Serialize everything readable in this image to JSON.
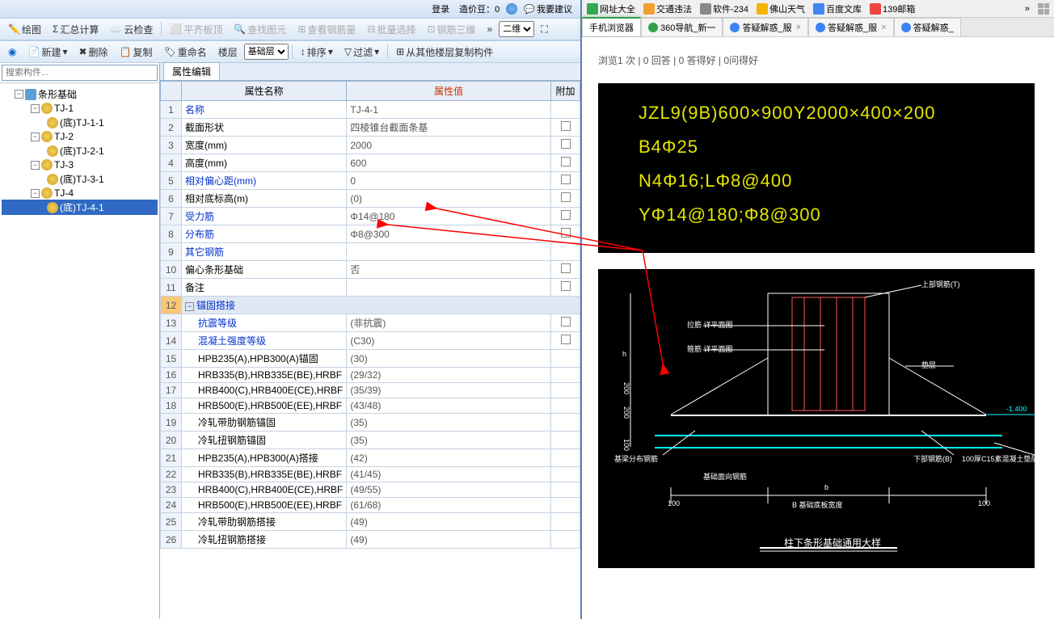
{
  "titlebar": {
    "login": "登录",
    "price": "造价豆：0",
    "feedback": "我要建议"
  },
  "toolbar1": {
    "draw": "绘图",
    "sum": "汇总计算",
    "cloud": "云检查",
    "flat": "平齐板顶",
    "find": "查找图元",
    "rebar": "查看钢筋量",
    "batch": "批量选择",
    "rebar3d": "钢筋三维",
    "view_select": "二维"
  },
  "toolbar2": {
    "new": "新建",
    "delete": "删除",
    "copy": "复制",
    "rename": "重命名",
    "floor": "楼层",
    "layer_select": "基础层",
    "sort": "排序",
    "filter": "过滤",
    "copy_from": "从其他楼层复制构件"
  },
  "search_placeholder": "搜索构件...",
  "tree": {
    "root": "条形基础",
    "items": [
      {
        "label": "TJ-1",
        "children": [
          "(底)TJ-1-1"
        ]
      },
      {
        "label": "TJ-2",
        "children": [
          "(底)TJ-2-1"
        ]
      },
      {
        "label": "TJ-3",
        "children": [
          "(底)TJ-3-1"
        ]
      },
      {
        "label": "TJ-4",
        "children": [
          "(底)TJ-4-1"
        ]
      }
    ],
    "selected": "(底)TJ-4-1"
  },
  "prop_tab": "属性编辑",
  "prop_headers": {
    "name": "属性名称",
    "value": "属性值",
    "extra": "附加"
  },
  "props": [
    {
      "n": 1,
      "name": "名称",
      "val": "TJ-4-1",
      "blue": true,
      "check": false
    },
    {
      "n": 2,
      "name": "截面形状",
      "val": "四棱锥台截面条基",
      "check": true
    },
    {
      "n": 3,
      "name": "宽度(mm)",
      "val": "2000",
      "check": true
    },
    {
      "n": 4,
      "name": "高度(mm)",
      "val": "600",
      "check": true
    },
    {
      "n": 5,
      "name": "相对偏心距(mm)",
      "val": "0",
      "blue": true,
      "check": true
    },
    {
      "n": 6,
      "name": "相对底标高(m)",
      "val": "(0)",
      "check": true
    },
    {
      "n": 7,
      "name": "受力筋",
      "val": "Φ14@180",
      "blue": true,
      "check": true
    },
    {
      "n": 8,
      "name": "分布筋",
      "val": "Φ8@300",
      "blue": true,
      "check": true
    },
    {
      "n": 9,
      "name": "其它钢筋",
      "val": "",
      "blue": true,
      "check": false
    },
    {
      "n": 10,
      "name": "偏心条形基础",
      "val": "否",
      "check": true
    },
    {
      "n": 11,
      "name": "备注",
      "val": "",
      "check": true
    },
    {
      "n": 12,
      "name": "锚固搭接",
      "group": true,
      "sel": true
    },
    {
      "n": 13,
      "name": "抗震等级",
      "val": "(非抗震)",
      "indent": true,
      "blue": true,
      "check": true
    },
    {
      "n": 14,
      "name": "混凝土强度等级",
      "val": "(C30)",
      "indent": true,
      "blue": true,
      "check": true
    },
    {
      "n": 15,
      "name": "HPB235(A),HPB300(A)锚固",
      "val": "(30)",
      "indent": true,
      "check": false
    },
    {
      "n": 16,
      "name": "HRB335(B),HRB335E(BE),HRBF",
      "val": "(29/32)",
      "indent": true,
      "check": false
    },
    {
      "n": 17,
      "name": "HRB400(C),HRB400E(CE),HRBF",
      "val": "(35/39)",
      "indent": true,
      "check": false
    },
    {
      "n": 18,
      "name": "HRB500(E),HRB500E(EE),HRBF",
      "val": "(43/48)",
      "indent": true,
      "check": false
    },
    {
      "n": 19,
      "name": "冷轧带肋钢筋锚固",
      "val": "(35)",
      "indent": true,
      "check": false
    },
    {
      "n": 20,
      "name": "冷轧扭钢筋锚固",
      "val": "(35)",
      "indent": true,
      "check": false
    },
    {
      "n": 21,
      "name": "HPB235(A),HPB300(A)搭接",
      "val": "(42)",
      "indent": true,
      "check": false
    },
    {
      "n": 22,
      "name": "HRB335(B),HRB335E(BE),HRBF",
      "val": "(41/45)",
      "indent": true,
      "check": false
    },
    {
      "n": 23,
      "name": "HRB400(C),HRB400E(CE),HRBF",
      "val": "(49/55)",
      "indent": true,
      "check": false
    },
    {
      "n": 24,
      "name": "HRB500(E),HRB500E(EE),HRBF",
      "val": "(61/68)",
      "indent": true,
      "check": false
    },
    {
      "n": 25,
      "name": "冷轧带肋钢筋搭接",
      "val": "(49)",
      "indent": true,
      "check": false
    },
    {
      "n": 26,
      "name": "冷轧扭钢筋搭接",
      "val": "(49)",
      "indent": true,
      "check": false
    }
  ],
  "bookmarks": [
    {
      "label": "网址大全",
      "color": "#34a853"
    },
    {
      "label": "交通违法",
      "color": "#f0a030"
    },
    {
      "label": "软件-234",
      "color": "#888"
    },
    {
      "label": "佛山天气",
      "color": "#f4b400"
    },
    {
      "label": "百度文库",
      "color": "#4285f4"
    },
    {
      "label": "139邮箱",
      "color": "#e44"
    }
  ],
  "btabs": [
    {
      "label": "手机浏览器",
      "active": true
    },
    {
      "label": "360导航_新一",
      "icon": "green"
    },
    {
      "label": "答疑解惑_服",
      "icon": "blue",
      "close": true
    },
    {
      "label": "答疑解惑_服",
      "icon": "blue",
      "close": true
    },
    {
      "label": "答疑解惑_",
      "icon": "blue"
    }
  ],
  "stats_text": "浏览1 次 | 0 回答 | 0 答得好 | 0问得好",
  "cad_lines": [
    "JZL9(9B)600×900Y2000×400×200",
    "B4Φ25",
    "N4Φ16;LΦ8@400",
    "YΦ14@180;Φ8@300"
  ],
  "cad2_title": "柱下条形基础通用大样",
  "cad2_labels": {
    "top_rebar": "上部钢筋(T)",
    "strap": "拉筋 详平面图",
    "stirrup": "箍筋 详平面图",
    "pad": "垫层",
    "elev": "-1.400",
    "dist_rebar": "基梁分布钢筋",
    "bot_rebar": "下部钢筋(B)",
    "note": "100厚C15素混凝土垫层",
    "tie": "基础面向钢筋",
    "width_label": "B 基础底板宽度",
    "dim100a": "100",
    "dim100b": "100",
    "dim100c": "100",
    "dim200a": "200",
    "dim200b": "200",
    "h": "h",
    "b": "b"
  }
}
